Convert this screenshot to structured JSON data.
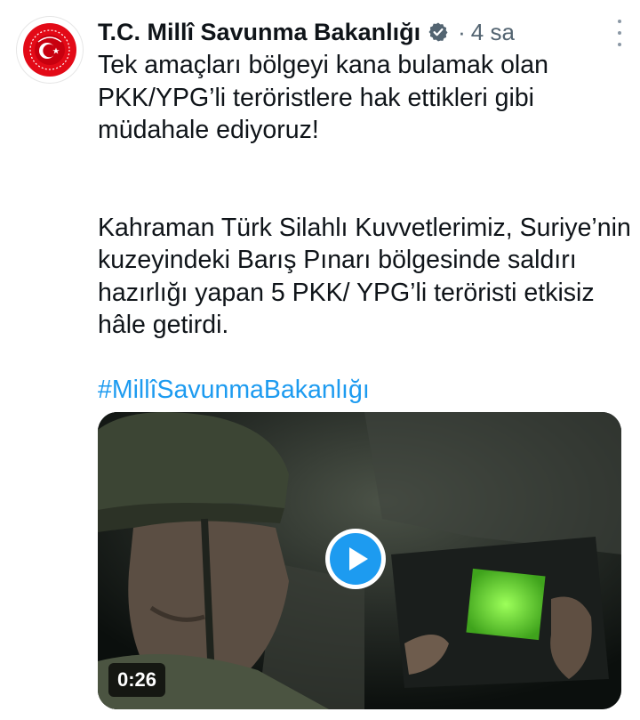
{
  "account": {
    "display_name": "T.C. Millî Savunma Bakanlığı",
    "separator": "·",
    "timestamp": "4 sa"
  },
  "tweet": {
    "paragraph_1": "Tek amaçları bölgeyi kana bulamak olan PKK/YPG’li teröristlere hak ettikleri gibi müdahale ediyoruz!",
    "paragraph_2": "Kahraman Türk Silahlı Kuvvetlerimiz, Suriye’nin kuzeyindeki Barış Pınarı bölgesinde saldırı hazırlığı yapan 5 PKK/ YPG’li teröristi etkisiz hâle getirdi.",
    "hashtag": "#MillîSavunmaBakanlığı"
  },
  "media": {
    "type": "video",
    "duration": "0:26",
    "play_icon": "play-icon"
  },
  "colors": {
    "link": "#1d9bf0",
    "verified_badge": "#536471",
    "play_button": "#1d9bf0",
    "secondary_text": "#536471",
    "avatar_red": "#e30a17"
  },
  "icons": [
    "ministry-emblem-icon",
    "verified-badge-icon",
    "more-options-icon",
    "play-icon"
  ]
}
